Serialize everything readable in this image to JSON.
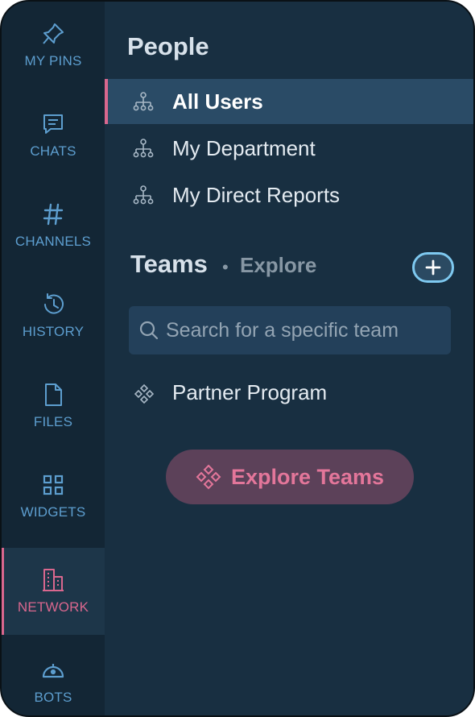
{
  "colors": {
    "accent": "#d9678e",
    "rail_text": "#5d9ecf",
    "selected_row": "#2a4b66",
    "panel_bg": "#182f41",
    "add_ring": "#7ec9f0"
  },
  "rail": {
    "items": [
      {
        "label": "MY PINS",
        "icon": "pin-icon"
      },
      {
        "label": "CHATS",
        "icon": "chat-icon"
      },
      {
        "label": "CHANNELS",
        "icon": "hash-icon"
      },
      {
        "label": "HISTORY",
        "icon": "history-icon"
      },
      {
        "label": "FILES",
        "icon": "file-icon"
      },
      {
        "label": "WIDGETS",
        "icon": "grid-icon"
      },
      {
        "label": "NETWORK",
        "icon": "building-icon",
        "active": true
      },
      {
        "label": "BOTS",
        "icon": "bot-icon"
      }
    ]
  },
  "people": {
    "title": "People",
    "items": [
      {
        "label": "All Users",
        "icon": "org-chart-icon",
        "selected": true
      },
      {
        "label": "My Department",
        "icon": "org-chart-icon"
      },
      {
        "label": "My Direct Reports",
        "icon": "org-chart-icon"
      }
    ]
  },
  "teams": {
    "title": "Teams",
    "separator": "•",
    "explore_link": "Explore",
    "add_icon": "plus-icon",
    "search_placeholder": "Search for a specific team",
    "items": [
      {
        "label": "Partner Program",
        "icon": "team-diamond-icon"
      }
    ],
    "explore_button": "Explore Teams"
  }
}
